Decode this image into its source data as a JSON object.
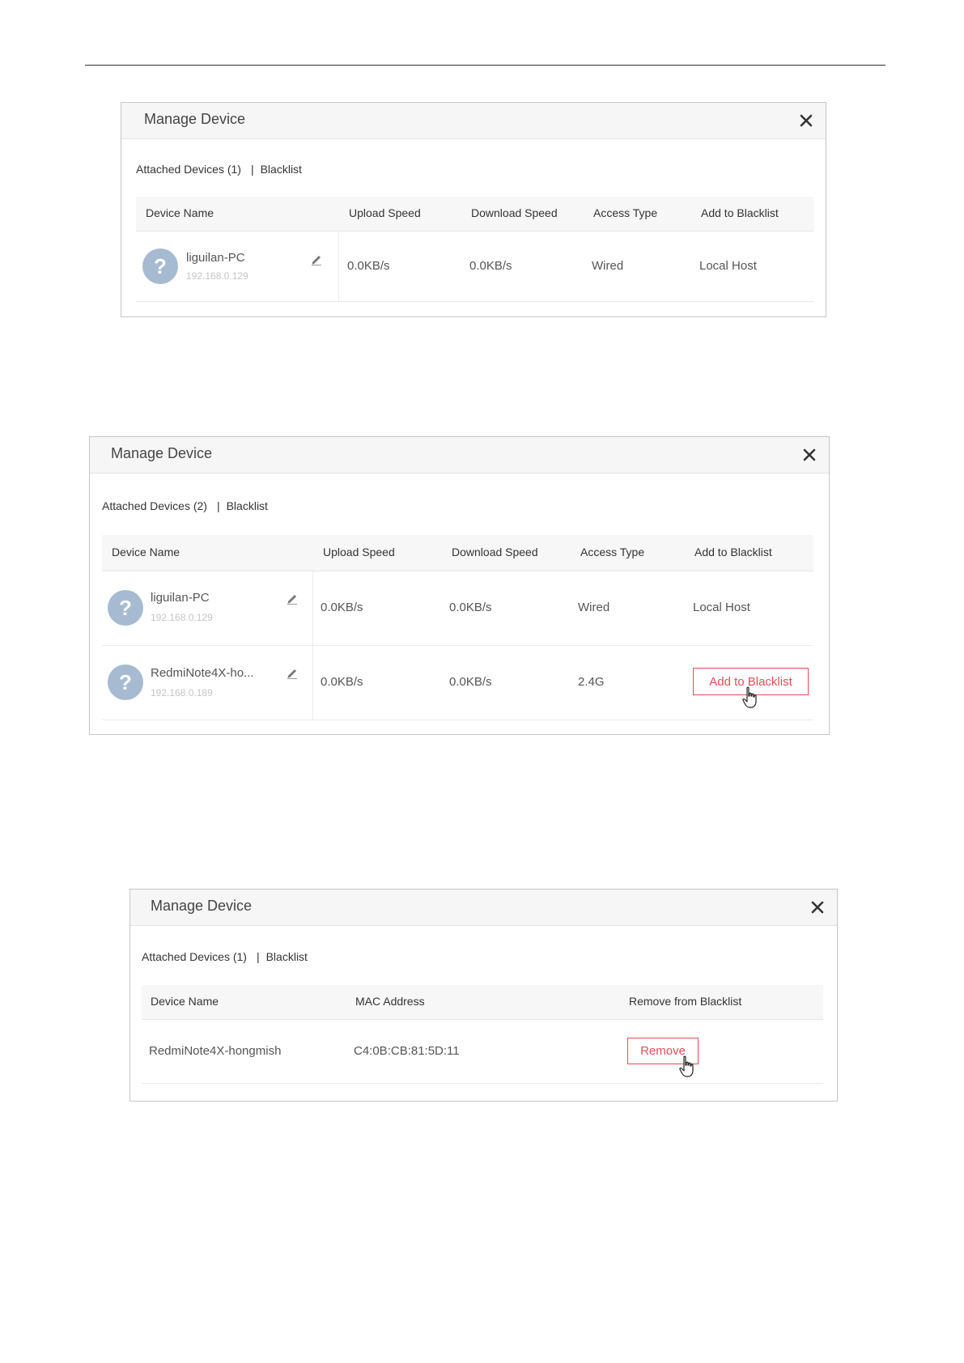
{
  "dialogs": [
    {
      "title": "Manage Device",
      "tabs": {
        "attached": "Attached Devices (1)",
        "separator": "|",
        "blacklist": "Blacklist"
      },
      "columns": [
        "Device Name",
        "Upload Speed",
        "Download Speed",
        "Access Type",
        "Add to Blacklist"
      ],
      "rows": [
        {
          "name": "liguilan-PC",
          "ip": "192.168.0.129",
          "upload": "0.0KB/s",
          "download": "0.0KB/s",
          "access": "Wired",
          "action": "Local Host"
        }
      ]
    },
    {
      "title": "Manage Device",
      "tabs": {
        "attached": "Attached Devices (2)",
        "separator": "|",
        "blacklist": "Blacklist"
      },
      "columns": [
        "Device Name",
        "Upload Speed",
        "Download Speed",
        "Access Type",
        "Add to Blacklist"
      ],
      "rows": [
        {
          "name": "liguilan-PC",
          "ip": "192.168.0.129",
          "upload": "0.0KB/s",
          "download": "0.0KB/s",
          "access": "Wired",
          "action": "Local Host"
        },
        {
          "name": "RedmiNote4X-ho...",
          "ip": "192.168.0.189",
          "upload": "0.0KB/s",
          "download": "0.0KB/s",
          "access": "2.4G",
          "action": "Add to Blacklist"
        }
      ]
    },
    {
      "title": "Manage Device",
      "tabs": {
        "attached": "Attached Devices (1)",
        "separator": "|",
        "blacklist": "Blacklist"
      },
      "columns": [
        "Device Name",
        "MAC Address",
        "Remove from Blacklist"
      ],
      "rows": [
        {
          "name": "RedmiNote4X-hongmish",
          "mac": "C4:0B:CB:81:5D:11",
          "action": "Remove"
        }
      ]
    }
  ],
  "icons": {
    "close": "close-icon",
    "edit": "pencil-icon",
    "avatar": "question-mark-icon",
    "cursor": "hand-pointer-icon"
  },
  "colors": {
    "accent_red": "#e0505a",
    "avatar_blue": "#a6bbd1"
  }
}
